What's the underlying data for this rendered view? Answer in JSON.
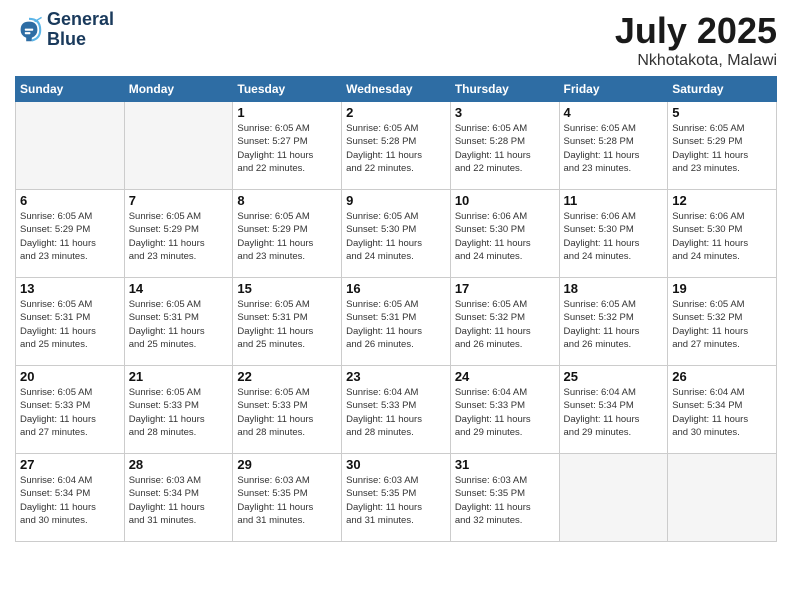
{
  "logo": {
    "line1": "General",
    "line2": "Blue"
  },
  "title": {
    "month_year": "July 2025",
    "location": "Nkhotakota, Malawi"
  },
  "weekdays": [
    "Sunday",
    "Monday",
    "Tuesday",
    "Wednesday",
    "Thursday",
    "Friday",
    "Saturday"
  ],
  "weeks": [
    [
      {
        "day": "",
        "info": ""
      },
      {
        "day": "",
        "info": ""
      },
      {
        "day": "1",
        "info": "Sunrise: 6:05 AM\nSunset: 5:27 PM\nDaylight: 11 hours\nand 22 minutes."
      },
      {
        "day": "2",
        "info": "Sunrise: 6:05 AM\nSunset: 5:28 PM\nDaylight: 11 hours\nand 22 minutes."
      },
      {
        "day": "3",
        "info": "Sunrise: 6:05 AM\nSunset: 5:28 PM\nDaylight: 11 hours\nand 22 minutes."
      },
      {
        "day": "4",
        "info": "Sunrise: 6:05 AM\nSunset: 5:28 PM\nDaylight: 11 hours\nand 23 minutes."
      },
      {
        "day": "5",
        "info": "Sunrise: 6:05 AM\nSunset: 5:29 PM\nDaylight: 11 hours\nand 23 minutes."
      }
    ],
    [
      {
        "day": "6",
        "info": "Sunrise: 6:05 AM\nSunset: 5:29 PM\nDaylight: 11 hours\nand 23 minutes."
      },
      {
        "day": "7",
        "info": "Sunrise: 6:05 AM\nSunset: 5:29 PM\nDaylight: 11 hours\nand 23 minutes."
      },
      {
        "day": "8",
        "info": "Sunrise: 6:05 AM\nSunset: 5:29 PM\nDaylight: 11 hours\nand 23 minutes."
      },
      {
        "day": "9",
        "info": "Sunrise: 6:05 AM\nSunset: 5:30 PM\nDaylight: 11 hours\nand 24 minutes."
      },
      {
        "day": "10",
        "info": "Sunrise: 6:06 AM\nSunset: 5:30 PM\nDaylight: 11 hours\nand 24 minutes."
      },
      {
        "day": "11",
        "info": "Sunrise: 6:06 AM\nSunset: 5:30 PM\nDaylight: 11 hours\nand 24 minutes."
      },
      {
        "day": "12",
        "info": "Sunrise: 6:06 AM\nSunset: 5:30 PM\nDaylight: 11 hours\nand 24 minutes."
      }
    ],
    [
      {
        "day": "13",
        "info": "Sunrise: 6:05 AM\nSunset: 5:31 PM\nDaylight: 11 hours\nand 25 minutes."
      },
      {
        "day": "14",
        "info": "Sunrise: 6:05 AM\nSunset: 5:31 PM\nDaylight: 11 hours\nand 25 minutes."
      },
      {
        "day": "15",
        "info": "Sunrise: 6:05 AM\nSunset: 5:31 PM\nDaylight: 11 hours\nand 25 minutes."
      },
      {
        "day": "16",
        "info": "Sunrise: 6:05 AM\nSunset: 5:31 PM\nDaylight: 11 hours\nand 26 minutes."
      },
      {
        "day": "17",
        "info": "Sunrise: 6:05 AM\nSunset: 5:32 PM\nDaylight: 11 hours\nand 26 minutes."
      },
      {
        "day": "18",
        "info": "Sunrise: 6:05 AM\nSunset: 5:32 PM\nDaylight: 11 hours\nand 26 minutes."
      },
      {
        "day": "19",
        "info": "Sunrise: 6:05 AM\nSunset: 5:32 PM\nDaylight: 11 hours\nand 27 minutes."
      }
    ],
    [
      {
        "day": "20",
        "info": "Sunrise: 6:05 AM\nSunset: 5:33 PM\nDaylight: 11 hours\nand 27 minutes."
      },
      {
        "day": "21",
        "info": "Sunrise: 6:05 AM\nSunset: 5:33 PM\nDaylight: 11 hours\nand 28 minutes."
      },
      {
        "day": "22",
        "info": "Sunrise: 6:05 AM\nSunset: 5:33 PM\nDaylight: 11 hours\nand 28 minutes."
      },
      {
        "day": "23",
        "info": "Sunrise: 6:04 AM\nSunset: 5:33 PM\nDaylight: 11 hours\nand 28 minutes."
      },
      {
        "day": "24",
        "info": "Sunrise: 6:04 AM\nSunset: 5:33 PM\nDaylight: 11 hours\nand 29 minutes."
      },
      {
        "day": "25",
        "info": "Sunrise: 6:04 AM\nSunset: 5:34 PM\nDaylight: 11 hours\nand 29 minutes."
      },
      {
        "day": "26",
        "info": "Sunrise: 6:04 AM\nSunset: 5:34 PM\nDaylight: 11 hours\nand 30 minutes."
      }
    ],
    [
      {
        "day": "27",
        "info": "Sunrise: 6:04 AM\nSunset: 5:34 PM\nDaylight: 11 hours\nand 30 minutes."
      },
      {
        "day": "28",
        "info": "Sunrise: 6:03 AM\nSunset: 5:34 PM\nDaylight: 11 hours\nand 31 minutes."
      },
      {
        "day": "29",
        "info": "Sunrise: 6:03 AM\nSunset: 5:35 PM\nDaylight: 11 hours\nand 31 minutes."
      },
      {
        "day": "30",
        "info": "Sunrise: 6:03 AM\nSunset: 5:35 PM\nDaylight: 11 hours\nand 31 minutes."
      },
      {
        "day": "31",
        "info": "Sunrise: 6:03 AM\nSunset: 5:35 PM\nDaylight: 11 hours\nand 32 minutes."
      },
      {
        "day": "",
        "info": ""
      },
      {
        "day": "",
        "info": ""
      }
    ]
  ]
}
